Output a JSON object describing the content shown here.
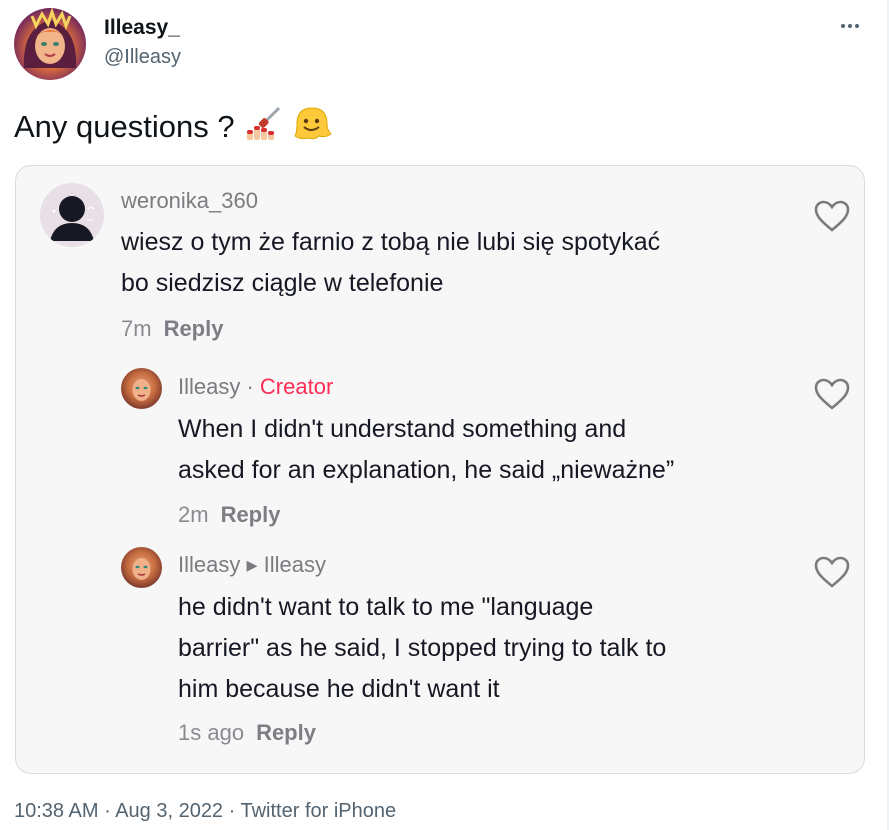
{
  "tweet": {
    "display_name": "Illeasy_",
    "handle": "@Illeasy",
    "text": "Any questions ?",
    "emojis": [
      "nail-polish-emoji",
      "melting-face-emoji"
    ],
    "footer": {
      "time": "10:38 AM",
      "sep1": " · ",
      "date": "Aug 3, 2022",
      "sep2": " · ",
      "source": "Twitter for iPhone"
    }
  },
  "comments": [
    {
      "user": "weronika_360",
      "text": "wiesz o tym że farnio z tobą nie lubi się spotykać\nbo siedzisz ciągle w telefonie",
      "time": "7m",
      "reply_label": "Reply"
    },
    {
      "user": "Illeasy",
      "sep": " · ",
      "badge": "Creator",
      "text": "When I didn't understand something and\nasked for an explanation, he said „nieważne”",
      "time": "2m",
      "reply_label": "Reply"
    },
    {
      "user": "Illeasy",
      "arrow": " ▸ ",
      "reply_to": "Illeasy",
      "text": "he didn't want to talk to me \"language\nbarrier\" as he said, I stopped trying to talk to\nhim because he didn't want it",
      "time": "1s ago",
      "reply_label": "Reply"
    }
  ],
  "colors": {
    "creator_badge": "#fe2c55",
    "secondary_text": "#536471",
    "card_bg": "#f7f7f8"
  }
}
